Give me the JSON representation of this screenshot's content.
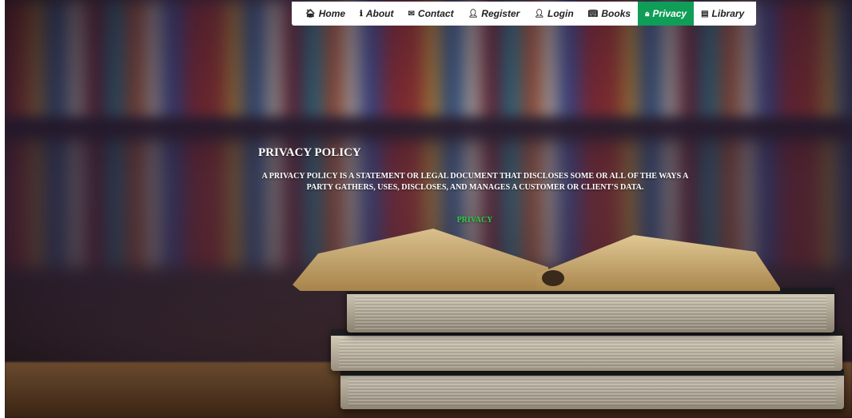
{
  "nav": {
    "items": [
      {
        "label": "Home",
        "icon": "home-icon",
        "glyph": "🏠︎",
        "active": false
      },
      {
        "label": "About",
        "icon": "info-icon",
        "glyph": "ℹ",
        "active": false
      },
      {
        "label": "Contact",
        "icon": "envelope-icon",
        "glyph": "✉",
        "active": false
      },
      {
        "label": "Register",
        "icon": "user-plus-icon",
        "glyph": "👤︎",
        "active": false
      },
      {
        "label": "Login",
        "icon": "user-icon",
        "glyph": "👤︎",
        "active": false
      },
      {
        "label": "Books",
        "icon": "book-open-icon",
        "glyph": "📖︎",
        "active": false
      },
      {
        "label": "Privacy",
        "icon": "lock-icon",
        "glyph": "🔒︎",
        "active": true
      },
      {
        "label": "Library",
        "icon": "book-icon",
        "glyph": "▤",
        "active": false
      }
    ],
    "active_color": "#0f9d58"
  },
  "main": {
    "title": "PRIVACY POLICY",
    "description": "A PRIVACY POLICY IS A STATEMENT OR LEGAL DOCUMENT THAT DISCLOSES SOME OR ALL OF THE WAYS A PARTY GATHERS, USES, DISCLOSES, AND MANAGES A CUSTOMER OR CLIENT'S DATA.",
    "link_label": "PRIVACY",
    "link_color": "#2ecc40"
  }
}
